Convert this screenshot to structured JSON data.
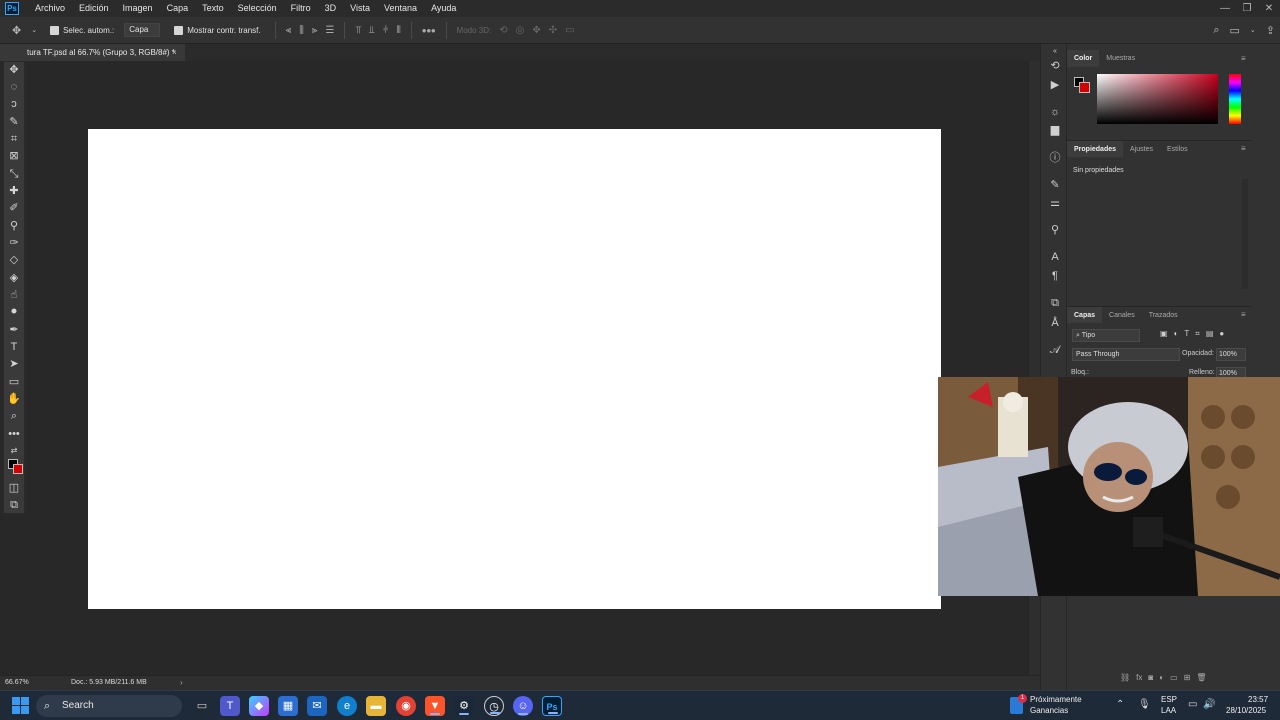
{
  "menubar": {
    "logo": "Ps",
    "items": [
      "Archivo",
      "Edición",
      "Imagen",
      "Capa",
      "Texto",
      "Selección",
      "Filtro",
      "3D",
      "Vista",
      "Ventana",
      "Ayuda"
    ]
  },
  "options": {
    "auto_select_label": "Selec. autom.:",
    "auto_select_value": "Capa",
    "show_transform_label": "Mostrar contr. transf.",
    "mode_3d_label": "Modo 3D:"
  },
  "document_tab": {
    "title": "tura TF.psd al 66.7% (Grupo 3, RGB/8#) *",
    "close": "×"
  },
  "status": {
    "zoom": "66.67%",
    "doc": "Doc.: 5.93 MB/211.6 MB",
    "arrow": "›"
  },
  "color_panel": {
    "tabs": [
      "Color",
      "Muestras"
    ],
    "foreground_color": "#000000",
    "background_color": "#d40000"
  },
  "properties_panel": {
    "tabs": [
      "Propiedades",
      "Ajustes",
      "Estilos"
    ],
    "empty_text": "Sin propiedades"
  },
  "layers_panel": {
    "tabs": [
      "Capas",
      "Canales",
      "Trazados"
    ],
    "search": "Tipo",
    "blend_mode": "Pass Through",
    "opacity_label": "Opacidad:",
    "opacity_value": "100%",
    "lock_label": "Bloq.:",
    "fill_label": "Relleno:",
    "fill_value": "100%"
  },
  "taskbar": {
    "search_placeholder": "Search",
    "weather_line1": "Próximamente",
    "weather_line2": "Ganancias",
    "weather_badge": "1",
    "lang_line1": "ESP",
    "lang_line2": "LAA",
    "time": "23:57",
    "date": "28/10/2025"
  }
}
